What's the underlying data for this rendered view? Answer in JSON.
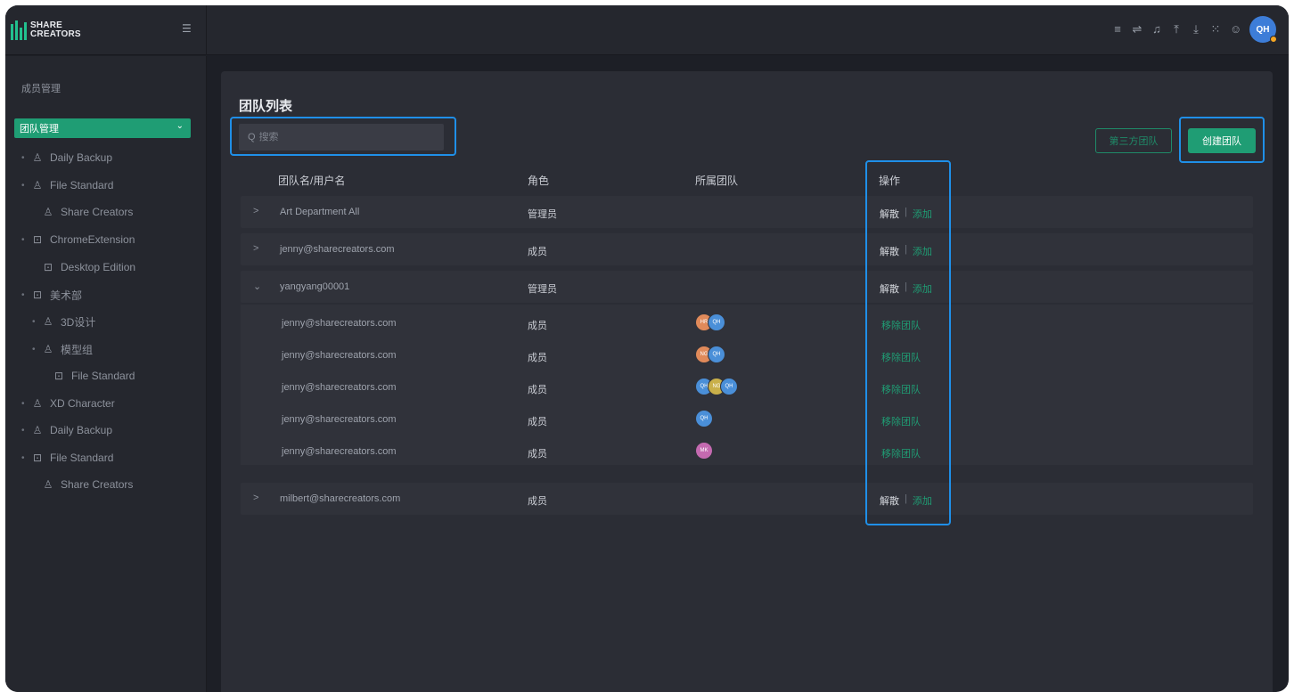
{
  "brand": {
    "line1": "SHARE",
    "line2": "CREATORS",
    "accent": "#22c08e"
  },
  "top_icons": [
    "list-icon",
    "transfer-icon",
    "bell-icon",
    "upload-icon",
    "download-icon",
    "expand-icon",
    "user-icon"
  ],
  "user": {
    "initials": "QH"
  },
  "sidebar": {
    "section": "成员管理",
    "active": "团队管理",
    "items": [
      {
        "label": "Daily Backup",
        "icon": "user-group-icon",
        "bullet": "•"
      },
      {
        "label": "File Standard",
        "icon": "user-group-icon",
        "bullet": "•"
      },
      {
        "label": "Share Creators",
        "icon": "user-group-icon",
        "bullet": ""
      },
      {
        "label": "ChromeExtension",
        "icon": "lock-icon",
        "bullet": "•"
      },
      {
        "label": "Desktop Edition",
        "icon": "lock-icon",
        "bullet": ""
      },
      {
        "label": "美术部",
        "icon": "lock-icon",
        "bullet": "•"
      },
      {
        "label": "3D设计",
        "icon": "user-group-icon",
        "bullet": "•"
      },
      {
        "label": "模型组",
        "icon": "user-group-icon",
        "bullet": "•"
      },
      {
        "label": "File Standard",
        "icon": "lock-icon",
        "bullet": ""
      },
      {
        "label": "XD Character",
        "icon": "user-group-icon",
        "bullet": "•"
      },
      {
        "label": "Daily Backup",
        "icon": "user-group-icon",
        "bullet": "•"
      },
      {
        "label": "File Standard",
        "icon": "lock-icon",
        "bullet": "•"
      },
      {
        "label": "Share Creators",
        "icon": "user-group-icon",
        "bullet": ""
      }
    ]
  },
  "main": {
    "title": "团队列表",
    "search_placeholder": "搜索",
    "third_party_button": "第三方团队",
    "create_button": "创建团队",
    "columns": [
      "团队名/用户名",
      "角色",
      "所属团队",
      "操作"
    ],
    "ops": {
      "dismiss": "解散",
      "separator": "|",
      "add": "添加",
      "exit": "移除团队"
    },
    "rows": [
      {
        "name": "Art Department All",
        "role": "管理员",
        "chevron": ">"
      },
      {
        "name": "jenny@sharecreators.com",
        "role": "成员",
        "chevron": ">"
      },
      {
        "name": "yangyang00001",
        "role": "管理员",
        "chevron": "⌄"
      }
    ],
    "sub_rows": [
      {
        "name": "jenny@sharecreators.com",
        "role": "成员",
        "teams": [
          {
            "t": "HR",
            "c": "#e08a5a"
          },
          {
            "t": "QH",
            "c": "#4a8fd8"
          }
        ]
      },
      {
        "name": "jenny@sharecreators.com",
        "role": "成员",
        "teams": [
          {
            "t": "NG",
            "c": "#e08a5a"
          },
          {
            "t": "QH",
            "c": "#4a8fd8"
          }
        ]
      },
      {
        "name": "jenny@sharecreators.com",
        "role": "成员",
        "teams": [
          {
            "t": "QH",
            "c": "#4a8fd8"
          },
          {
            "t": "NG",
            "c": "#c9b04a"
          },
          {
            "t": "QH",
            "c": "#4a8fd8"
          }
        ]
      },
      {
        "name": "jenny@sharecreators.com",
        "role": "成员",
        "teams": [
          {
            "t": "QH",
            "c": "#4a8fd8"
          }
        ]
      },
      {
        "name": "jenny@sharecreators.com",
        "role": "成员",
        "teams": [
          {
            "t": "MK",
            "c": "#c46ab0"
          }
        ]
      }
    ],
    "last_row": {
      "name": "milbert@sharecreators.com",
      "role": "成员",
      "chevron": ">"
    }
  }
}
